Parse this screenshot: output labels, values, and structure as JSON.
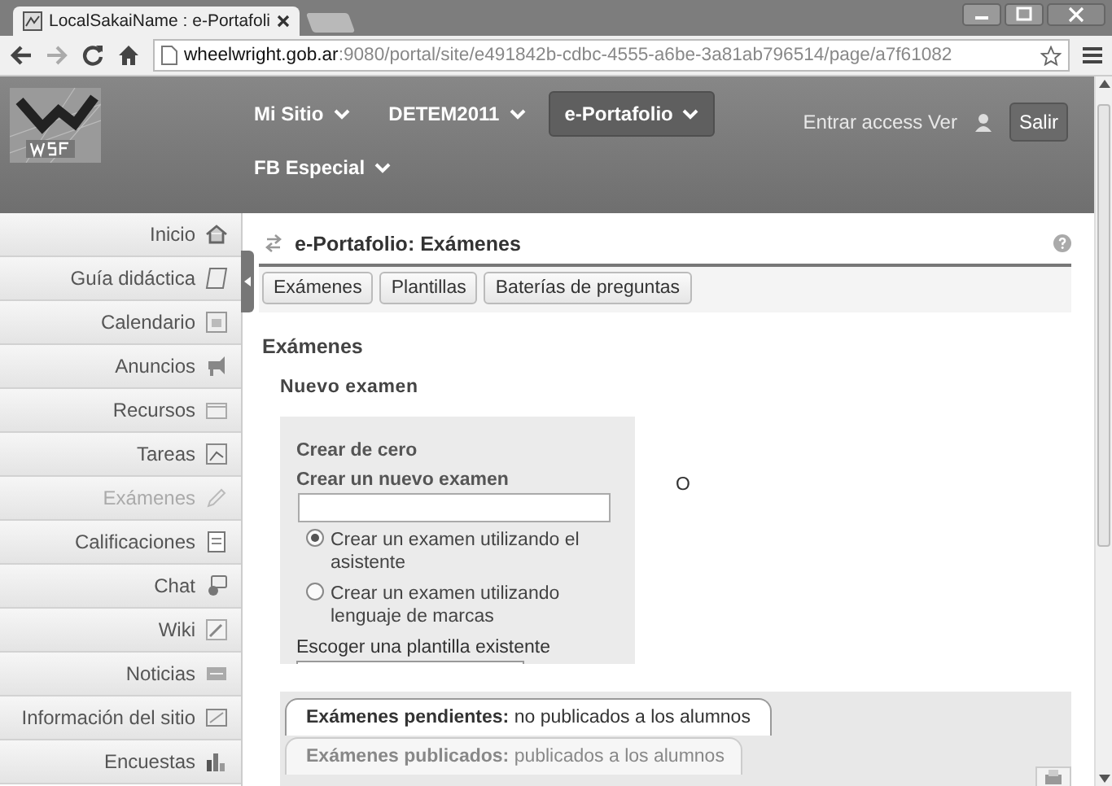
{
  "browser": {
    "tab_title": "LocalSakaiName : e-Portafoli",
    "url_host": "wheelwright.gob.ar",
    "url_path": ":9080/portal/site/e491842b-cdbc-4555-a6be-3a81ab796514/page/a7f61082"
  },
  "header": {
    "nav": [
      {
        "label": "Mi Sitio",
        "selected": false
      },
      {
        "label": "DETEM2011",
        "selected": false
      },
      {
        "label": "e-Portafolio",
        "selected": true
      },
      {
        "label": "FB Especial",
        "selected": false
      }
    ],
    "user": "Entrar access Ver",
    "logout": "Salir"
  },
  "sidebar": {
    "items": [
      {
        "label": "Inicio",
        "selected": false
      },
      {
        "label": "Guía didáctica",
        "selected": false
      },
      {
        "label": "Calendario",
        "selected": false
      },
      {
        "label": "Anuncios",
        "selected": false
      },
      {
        "label": "Recursos",
        "selected": false
      },
      {
        "label": "Tareas",
        "selected": false
      },
      {
        "label": "Exámenes",
        "selected": true
      },
      {
        "label": "Calificaciones",
        "selected": false
      },
      {
        "label": "Chat",
        "selected": false
      },
      {
        "label": "Wiki",
        "selected": false
      },
      {
        "label": "Noticias",
        "selected": false
      },
      {
        "label": "Información del sitio",
        "selected": false
      },
      {
        "label": "Encuestas",
        "selected": false
      }
    ]
  },
  "tool": {
    "title": "e-Portafolio: Exámenes",
    "buttons": [
      "Exámenes",
      "Plantillas",
      "Baterías de preguntas"
    ],
    "heading": "Exámenes",
    "subheading": "Nuevo examen",
    "panel": {
      "title": "Crear de cero",
      "field_label": "Crear un nuevo examen",
      "options": [
        {
          "label": "Crear un examen utilizando el asistente",
          "selected": true
        },
        {
          "label": "Crear un examen utilizando lenguaje de marcas",
          "selected": false
        }
      ],
      "template_label": "Escoger una plantilla existente"
    },
    "separator": "O",
    "tabs": [
      {
        "label": "**Exámenes pendientes:** no publicados a los alumnos",
        "selected": true
      },
      {
        "label": "**Exámenes publicados:** publicados a los alumnos",
        "selected": false
      }
    ]
  }
}
